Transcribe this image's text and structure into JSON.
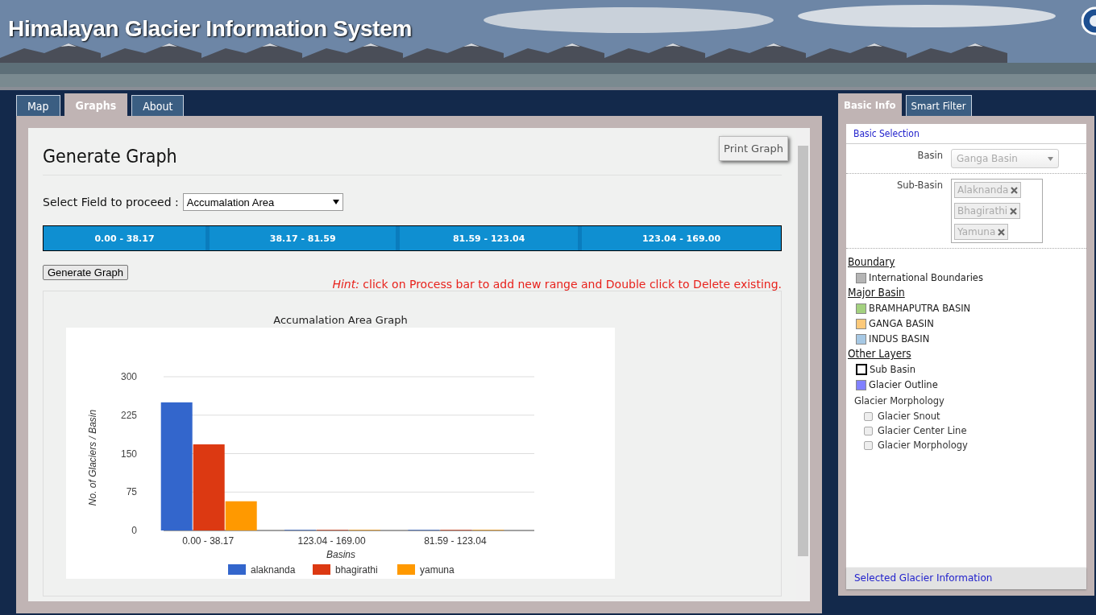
{
  "header": {
    "title": "Himalayan Glacier Information System"
  },
  "tabs": [
    {
      "label": "Map",
      "selected": false
    },
    {
      "label": "Graphs",
      "selected": true
    },
    {
      "label": "About",
      "selected": false
    }
  ],
  "graph_panel": {
    "title": "Generate Graph",
    "print_button": "Print Graph",
    "field_label": "Select Field to proceed :",
    "field_value": "Accumalation Area",
    "ranges": [
      "0.00 - 38.17",
      "38.17 - 81.59",
      "81.59 - 123.04",
      "123.04 - 169.00"
    ],
    "generate_button": "Generate Graph",
    "hint_label": "Hint:",
    "hint_text": "click on Process bar to add new range and Double click to Delete existing.",
    "chart_data": {
      "type": "bar",
      "title": "Accumalation Area Graph",
      "xlabel": "Basins",
      "ylabel": "No. of Glaciers / Basin",
      "categories": [
        "0.00 - 38.17",
        "123.04 - 169.00",
        "81.59 - 123.04"
      ],
      "series": [
        {
          "name": "alaknanda",
          "color": "#3366cc",
          "values": [
            250,
            1,
            1
          ]
        },
        {
          "name": "bhagirathi",
          "color": "#dc3912",
          "values": [
            168,
            1,
            1
          ]
        },
        {
          "name": "yamuna",
          "color": "#ff9900",
          "values": [
            57,
            1,
            1
          ]
        }
      ],
      "ylim": [
        0,
        300
      ],
      "grid": true,
      "legend": true,
      "yticks": [
        0,
        75,
        150,
        225,
        300
      ]
    }
  },
  "side_tabs": [
    {
      "label": "Basic Info",
      "selected": true
    },
    {
      "label": "Smart Filter",
      "selected": false
    }
  ],
  "side_panel": {
    "section_title": "Basic Selection",
    "basin_label": "Basin",
    "basin_value": "Ganga Basin",
    "sub_basin_label": "Sub-Basin",
    "sub_basins": [
      "Alaknanda",
      "Bhagirathi",
      "Yamuna"
    ],
    "layer_groups": [
      {
        "title": "Boundary",
        "items": [
          {
            "label": "International Boundaries",
            "kind": "swatch",
            "color": "#b4b4b4"
          }
        ]
      },
      {
        "title": "Major Basin",
        "items": [
          {
            "label": "BRAMHAPUTRA BASIN",
            "kind": "swatch",
            "color": "#a3d17f"
          },
          {
            "label": "GANGA BASIN",
            "kind": "swatch",
            "color": "#fcc97a"
          },
          {
            "label": "INDUS BASIN",
            "kind": "swatch",
            "color": "#a6c8e4"
          }
        ]
      },
      {
        "title": "Other Layers",
        "items": [
          {
            "label": "Sub Basin",
            "kind": "outline",
            "color": "#000000"
          },
          {
            "label": "Glacier Outline",
            "kind": "swatch",
            "color": "#8080ff"
          }
        ]
      }
    ],
    "morphology_title": "Glacier Morphology",
    "morphology_layers": [
      {
        "label": "Glacier Snout",
        "checked": false
      },
      {
        "label": "Glacier Center Line",
        "checked": false
      },
      {
        "label": "Glacier Morphology",
        "checked": false
      }
    ],
    "footer": "Selected Glacier Information"
  }
}
